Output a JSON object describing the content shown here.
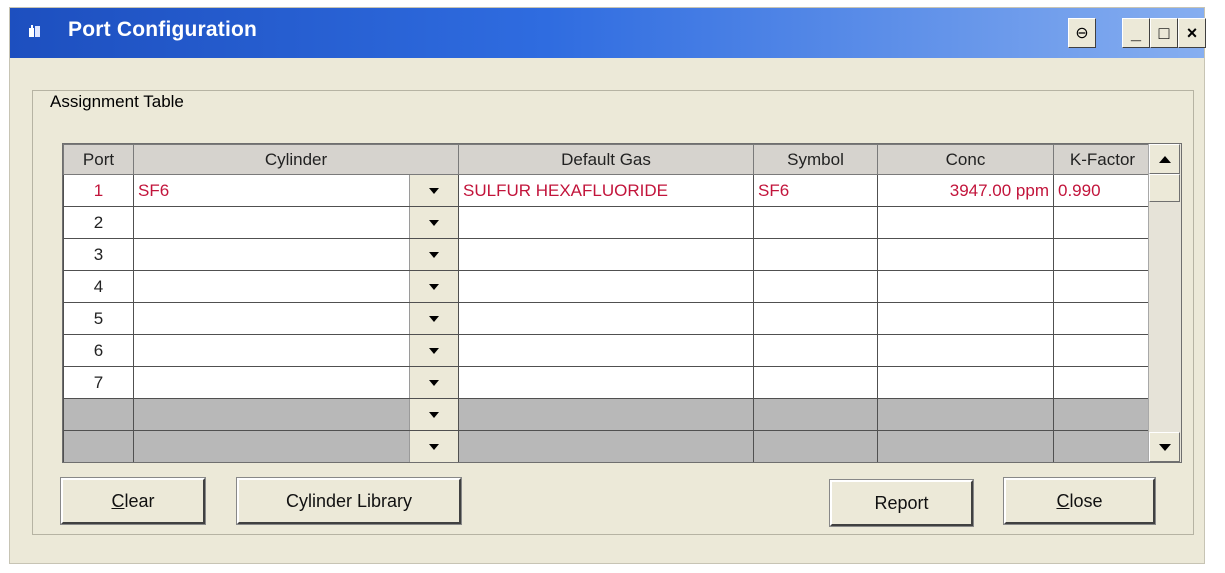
{
  "window": {
    "title": "Port Configuration",
    "restore_symbol": "⊖",
    "minimize_symbol": "_",
    "maximize_symbol": "□",
    "close_symbol": "×"
  },
  "assignment": {
    "group_label": "Assignment Table",
    "headers": {
      "port": "Port",
      "cylinder": "Cylinder",
      "default_gas": "Default Gas",
      "symbol": "Symbol",
      "conc": "Conc",
      "kfactor": "K-Factor"
    },
    "rows": [
      {
        "port": "1",
        "cylinder": "SF6",
        "default_gas": "SULFUR HEXAFLUORIDE",
        "symbol": "SF6",
        "conc": "3947.00 ppm",
        "kfactor": "0.990"
      },
      {
        "port": "2",
        "cylinder": "",
        "default_gas": "",
        "symbol": "",
        "conc": "",
        "kfactor": ""
      },
      {
        "port": "3",
        "cylinder": "",
        "default_gas": "",
        "symbol": "",
        "conc": "",
        "kfactor": ""
      },
      {
        "port": "4",
        "cylinder": "",
        "default_gas": "",
        "symbol": "",
        "conc": "",
        "kfactor": ""
      },
      {
        "port": "5",
        "cylinder": "",
        "default_gas": "",
        "symbol": "",
        "conc": "",
        "kfactor": ""
      },
      {
        "port": "6",
        "cylinder": "",
        "default_gas": "",
        "symbol": "",
        "conc": "",
        "kfactor": ""
      },
      {
        "port": "7",
        "cylinder": "",
        "default_gas": "",
        "symbol": "",
        "conc": "",
        "kfactor": ""
      },
      {
        "port": "",
        "cylinder": "",
        "default_gas": "",
        "symbol": "",
        "conc": "",
        "kfactor": ""
      },
      {
        "port": "",
        "cylinder": "",
        "default_gas": "",
        "symbol": "",
        "conc": "",
        "kfactor": ""
      }
    ]
  },
  "buttons": {
    "clear_mnemonic": "C",
    "clear_rest": "lear",
    "cylinder_library": "Cylinder Library",
    "report": "Report",
    "close_mnemonic": "C",
    "close_rest": "lose"
  },
  "colors": {
    "title_gradient_start": "#1d4fbf",
    "highlight_text": "#c2143b",
    "empty_row": "#b8b8b8"
  }
}
